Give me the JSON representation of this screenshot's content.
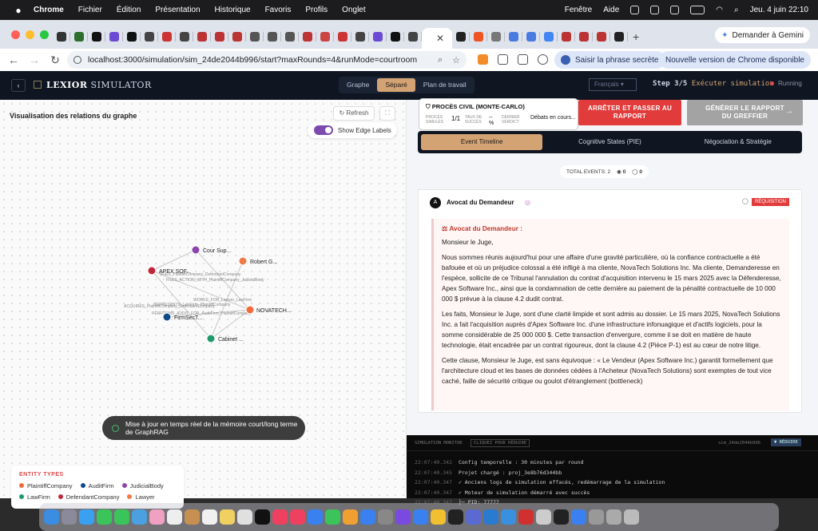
{
  "menubar": {
    "app": "Chrome",
    "items": [
      "Fichier",
      "Édition",
      "Présentation",
      "Historique",
      "Favoris",
      "Profils",
      "Onglet"
    ],
    "right_items": [
      "Fenêtre",
      "Aide"
    ],
    "clock": "Jeu. 4 juin 22:10"
  },
  "browser": {
    "gemini_label": "Demander à Gemini",
    "url": "localhost:3000/simulation/sim_24de2044b996/start?maxRounds=4&runMode=courtroom",
    "passphrase_label": "Saisir la phrase secrète",
    "update_label": "Nouvelle version de Chrome disponible"
  },
  "app": {
    "brand_prefix": "LEXIOR",
    "brand_suffix": "SIMULATOR",
    "view_tabs": [
      "Graphe",
      "Séparé",
      "Plan de travail"
    ],
    "active_view": "Séparé",
    "language": "Français",
    "step_prefix": "Step 3/5",
    "step_label": "Exécuter simulation",
    "status": "Running"
  },
  "graph_panel": {
    "title": "Visualisation des relations du graphe",
    "refresh_label": "Refresh",
    "edge_labels_toggle": "Show Edge Labels",
    "nodes": [
      {
        "label": "Cour Sup...",
        "type": "JudicialBody"
      },
      {
        "label": "Robert G...",
        "type": "Lawyer"
      },
      {
        "label": "APEX SOF...",
        "type": "DefendantCompany"
      },
      {
        "label": "NOVATECH...",
        "type": "PlaintiffCompany"
      },
      {
        "label": "FirmSecT...",
        "type": "AuditFirm"
      },
      {
        "label": "Cabinet ...",
        "type": "LawFirm"
      }
    ],
    "edge_labels": [
      "SUES_PlaintiffCompany_DefendantCompany",
      "FILES_ACTION_WITH_PlaintiffCompany_JudicialBody",
      "WORKS_FOR_Lawyer_LawFirm",
      "REPRESENTS_LawFirm_PlaintiffCompany",
      "ACQUIRES_PlaintiffCompany_DefendantCompany",
      "PERFORMS_AUDIT_FOR_AuditFirm_PlaintiffCompany"
    ],
    "toast": "Mise à jour en temps réel de la mémoire court/long terme de GraphRAG",
    "legend_title": "ENTITY TYPES",
    "legend": [
      {
        "label": "PlaintiffCompany",
        "color": "#f26b3a"
      },
      {
        "label": "AuditFirm",
        "color": "#0e4a8a"
      },
      {
        "label": "JudicialBody",
        "color": "#8e44ad"
      },
      {
        "label": "LawFirm",
        "color": "#1e9a6a"
      },
      {
        "label": "DefendantCompany",
        "color": "#c0283a"
      },
      {
        "label": "Lawyer",
        "color": "#f07a45"
      }
    ]
  },
  "case": {
    "title": "PROCÈS CIVIL (MONTE-CARLO)",
    "metric1_label": "PROCÈS SIMULÉS",
    "metric1_value": "1/1",
    "metric2_label": "TAUX DE SUCCÈS",
    "metric2_value": "-- %",
    "metric3_label": "DERNIER VERDICT",
    "metric3_value": "Débats en cours...",
    "stop_button": "ARRÊTER ET PASSER AU RAPPORT",
    "report_button": "GÉNÉRER LE RAPPORT DU GREFFIER"
  },
  "timeline": {
    "tabs": [
      "Event Timeline",
      "Cognitive States (PIE)",
      "Négociation & Stratégie"
    ],
    "total_events": "TOTAL EVENTS: 2",
    "count_a": "0",
    "count_b": "0"
  },
  "event": {
    "avatar": "A",
    "speaker": "Avocat du Demandeur",
    "tag": "RÉQUISITION",
    "heading": "Avocat du Demandeur :",
    "p1": "Monsieur le Juge,",
    "p2": "Nous sommes réunis aujourd'hui pour une affaire d'une gravité particulière, où la confiance contractuelle a été bafouée et où un préjudice colossal a été infligé à ma cliente, NovaTech Solutions Inc. Ma cliente, Demanderesse en l'espèce, sollicite de ce Tribunal l'annulation du contrat d'acquisition intervenu le 15 mars 2025 avec la Défenderesse, Apex Software Inc., ainsi que la condamnation de cette dernière au paiement de la pénalité contractuelle de 10 000 000 $ prévue à la clause 4.2 dudit contrat.",
    "p3": "Les faits, Monsieur le Juge, sont d'une clarté limpide et sont admis au dossier. Le 15 mars 2025, NovaTech Solutions Inc. a fait l'acquisition auprès d'Apex Software Inc. d'une infrastructure infonuagique et d'actifs logiciels, pour la somme considérable de 25 000 000 $. Cette transaction d'envergure, comme il se doit en matière de haute technologie, était encadrée par un contrat rigoureux, dont la clause 4.2 (Pièce P-1) est au cœur de notre litige.",
    "p4": "Cette clause, Monsieur le Juge, est sans équivoque : « Le Vendeur (Apex Software Inc.) garantit formellement que l'architecture cloud et les bases de données cédées à l'Acheteur (NovaTech Solutions) sont exemptes de tout vice caché, faille de sécurité critique ou goulot d'étranglement (bottleneck)"
  },
  "monitor": {
    "title": "SIMULATION MONITOR",
    "hint": "CLIQUEZ POUR RÉDUIRE",
    "sim_id": "sim_24de2044b996",
    "reduce": "▼ RÉDUIRE",
    "logs": [
      {
        "ts": "22:07:40.342",
        "text": "Config temporelle : 30 minutes par round"
      },
      {
        "ts": "22:07:40.345",
        "text": "Projet chargé : proj_3e8b76d344bb"
      },
      {
        "ts": "22:07:40.347",
        "text": "✓ Anciens logs de simulation effacés, redémarrage de la simulation"
      },
      {
        "ts": "22:07:40.347",
        "text": "✓ Moteur de simulation démarré avec succès"
      },
      {
        "ts": "22:07:40.347",
        "text": "├─ PID: 77777"
      }
    ]
  }
}
